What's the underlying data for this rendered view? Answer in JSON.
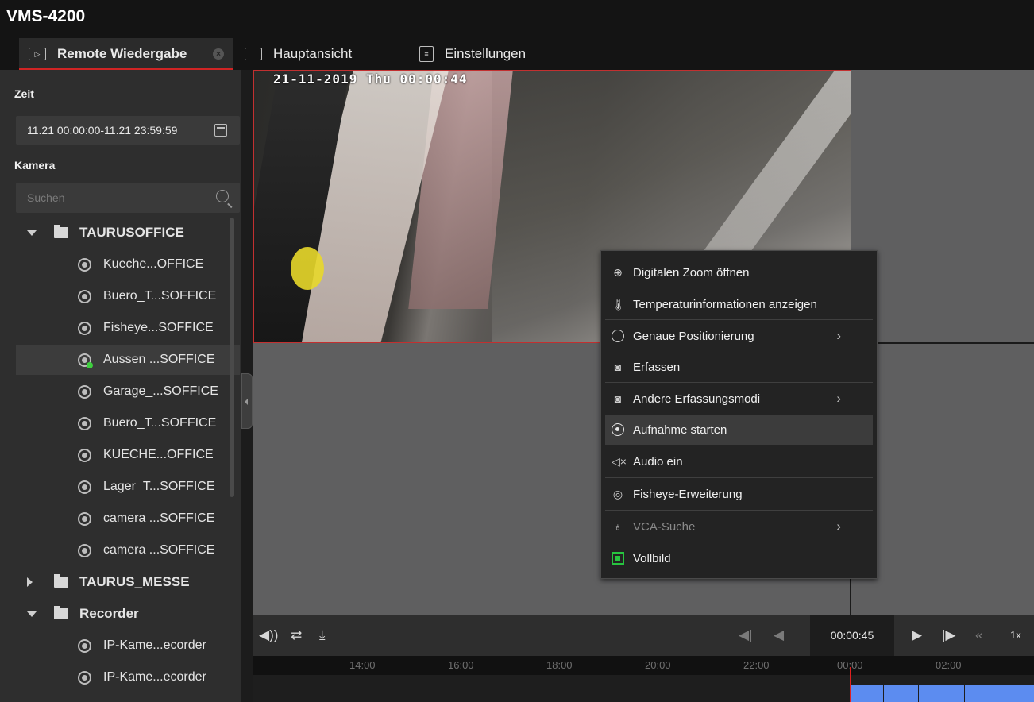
{
  "app": {
    "title": "VMS-4200"
  },
  "tabs": [
    {
      "label": "Remote Wiedergabe",
      "icon": "playback-icon",
      "active": true
    },
    {
      "label": "Hauptansicht",
      "icon": "main-view-icon"
    },
    {
      "label": "Einstellungen",
      "icon": "settings-icon"
    }
  ],
  "left": {
    "time_label": "Zeit",
    "time_range": "11.21 00:00:00-11.21 23:59:59",
    "camera_label": "Kamera",
    "search_placeholder": "Suchen",
    "groups": [
      {
        "name": "TAURUSOFFICE",
        "expanded": true,
        "cameras": [
          "Kueche...OFFICE",
          "Buero_T...SOFFICE",
          "Fisheye...SOFFICE",
          "Aussen ...SOFFICE",
          "Garage_...SOFFICE",
          "Buero_T...SOFFICE",
          "KUECHE...OFFICE",
          "Lager_T...SOFFICE",
          "camera ...SOFFICE",
          "camera ...SOFFICE"
        ],
        "selected_index": 3
      },
      {
        "name": "TAURUS_MESSE",
        "expanded": false
      },
      {
        "name": "Recorder",
        "expanded": true,
        "cameras": [
          "IP-Kame...ecorder",
          "IP-Kame...ecorder"
        ]
      }
    ]
  },
  "video": {
    "osd_text": "21-11-2019 Thu 00:00:44"
  },
  "context_menu": {
    "items": [
      {
        "label": "Digitalen Zoom öffnen",
        "icon": "zoom-in-icon"
      },
      {
        "label": "Temperaturinformationen anzeigen",
        "icon": "thermometer-icon"
      },
      {
        "label": "Genaue Positionierung",
        "icon": "timer-icon",
        "submenu": true
      },
      {
        "label": "Erfassen",
        "icon": "camera-icon"
      },
      {
        "label": "Andere Erfassungsmodi",
        "icon": "camera-icon",
        "submenu": true
      },
      {
        "label": "Aufnahme starten",
        "icon": "record-icon",
        "hover": true
      },
      {
        "label": "Audio ein",
        "icon": "audio-muted-icon"
      },
      {
        "label": "Fisheye-Erweiterung",
        "icon": "fisheye-icon"
      },
      {
        "label": "VCA-Suche",
        "icon": "bulb-icon",
        "submenu": true,
        "disabled": true
      },
      {
        "label": "Vollbild",
        "icon": "fullscreen-icon"
      }
    ]
  },
  "controls": {
    "current_time": "00:00:45",
    "speed": "1x"
  },
  "timeline": {
    "ticks": [
      "14:00",
      "16:00",
      "18:00",
      "20:00",
      "22:00",
      "00:00",
      "02:00"
    ]
  },
  "colors": {
    "accent_red": "#d02424",
    "record_blue": "#5c8cf0",
    "fullscreen_green": "#27c43f"
  }
}
